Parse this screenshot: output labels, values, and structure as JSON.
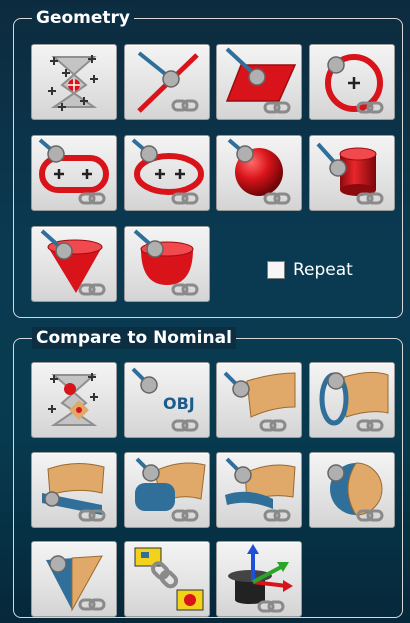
{
  "geometry": {
    "title": "Geometry",
    "tools": [
      {
        "icon": "sparse-points-icon"
      },
      {
        "icon": "line-icon"
      },
      {
        "icon": "plane-icon"
      },
      {
        "icon": "circle-icon"
      },
      {
        "icon": "slot-icon"
      },
      {
        "icon": "ellipse-icon"
      },
      {
        "icon": "sphere-icon"
      },
      {
        "icon": "cylinder-icon"
      },
      {
        "icon": "cone-icon"
      },
      {
        "icon": "paraboloid-icon"
      }
    ],
    "repeat_label": "Repeat",
    "repeat_checked": false
  },
  "compare": {
    "title": "Compare to Nominal",
    "tools": [
      {
        "icon": "compare-points-icon"
      },
      {
        "icon": "obj-surface-icon",
        "label": "OBJ"
      },
      {
        "icon": "surface-point-icon"
      },
      {
        "icon": "cylindrical-surface-icon"
      },
      {
        "icon": "surface-edge-icon"
      },
      {
        "icon": "cylinder-surface-icon"
      },
      {
        "icon": "surface-curve-icon"
      },
      {
        "icon": "sphere-surface-icon"
      },
      {
        "icon": "cone-surface-icon"
      },
      {
        "icon": "feature-chain-icon"
      },
      {
        "icon": "coordinate-system-icon"
      }
    ]
  },
  "colors": {
    "accent_red": "#d8141a",
    "chain_gray": "#8a8a8a",
    "surface_tan": "#e0a869",
    "surface_blue": "#2f6f9a",
    "background": "#0a3a52"
  }
}
